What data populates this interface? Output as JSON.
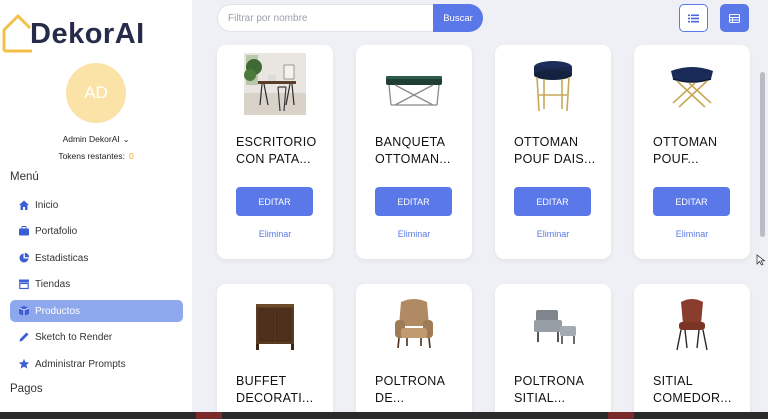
{
  "app": {
    "logo_text": "DekorAI"
  },
  "user": {
    "avatar_initials": "AD",
    "name": "Admin DekorAI",
    "tokens_label": "Tokens restantes:",
    "tokens_count": "0"
  },
  "menu": {
    "section_label": "Menú",
    "items": [
      {
        "label": "Inicio",
        "icon": "home-icon"
      },
      {
        "label": "Portafolio",
        "icon": "briefcase-icon"
      },
      {
        "label": "Estadisticas",
        "icon": "pie-chart-icon"
      },
      {
        "label": "Tiendas",
        "icon": "store-icon"
      },
      {
        "label": "Productos",
        "icon": "box-icon",
        "active": true
      },
      {
        "label": "Sketch to Render",
        "icon": "pencil-icon"
      },
      {
        "label": "Administrar Prompts",
        "icon": "star-icon"
      }
    ],
    "section2_label": "Pagos"
  },
  "search": {
    "placeholder": "Filtrar por nombre",
    "value": "",
    "button_label": "Buscar"
  },
  "view_toggle": {
    "list_icon": "list-view-icon",
    "grid_icon": "grid-view-icon"
  },
  "products": [
    {
      "title": "ESCRITORIO CON PATA...",
      "edit_label": "EDITAR",
      "delete_label": "Eliminar",
      "image": "desk-photo"
    },
    {
      "title": "BANQUETA OTTOMAN...",
      "edit_label": "EDITAR",
      "delete_label": "Eliminar",
      "image": "bench-photo"
    },
    {
      "title": "OTTOMAN POUF DAIS...",
      "edit_label": "EDITAR",
      "delete_label": "Eliminar",
      "image": "ottoman-daisy-photo"
    },
    {
      "title": "OTTOMAN POUF...",
      "edit_label": "EDITAR",
      "delete_label": "Eliminar",
      "image": "ottoman-x-photo"
    },
    {
      "title": "BUFFET DECORATI...",
      "image": "buffet-photo"
    },
    {
      "title": "POLTRONA DE...",
      "image": "armchair-photo"
    },
    {
      "title": "POLTRONA SITIAL...",
      "image": "grey-chair-photo"
    },
    {
      "title": "SITIAL COMEDOR...",
      "image": "dining-chair-photo"
    }
  ],
  "colors": {
    "accent": "#5a78e8",
    "active_nav": "#8ea8ee",
    "avatar_bg": "#fbe3a8",
    "token_count": "#f0a92a"
  }
}
